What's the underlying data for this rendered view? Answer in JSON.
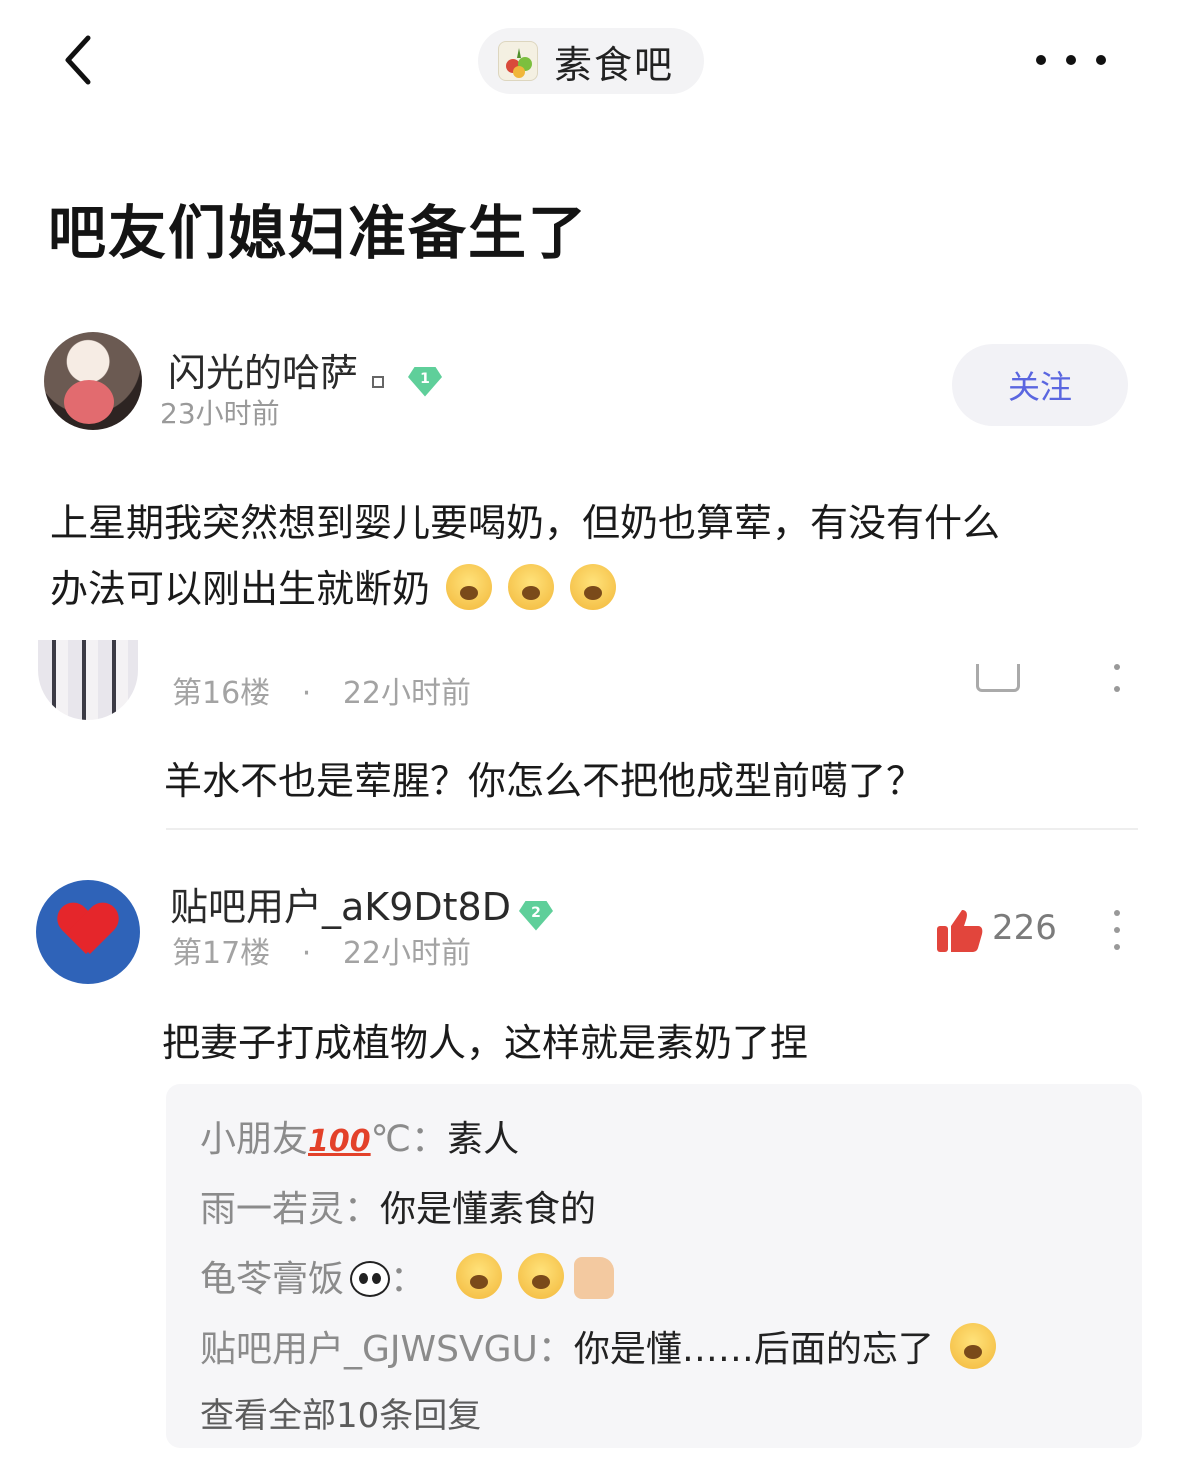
{
  "header": {
    "forum_name": "素食吧",
    "back_icon": "chevron-left-icon",
    "more_icon": "more-horizontal-icon"
  },
  "post": {
    "title": "吧友们媳妇准备生了",
    "author": {
      "name": "闪光的哈萨",
      "level": "1",
      "time": "23小时前"
    },
    "follow_label": "关注",
    "content_line1": "上星期我突然想到婴儿要喝奶，但奶也算荤，有没有什么",
    "content_line2": "办法可以刚出生就断奶"
  },
  "replies": [
    {
      "floor": "第16楼",
      "time": "22小时前",
      "text": "羊水不也是荤腥？你怎么不把他成型前噶了？"
    },
    {
      "author": "贴吧用户_aK9Dt8D",
      "level": "2",
      "floor": "第17楼",
      "time": "22小时前",
      "likes": "226",
      "text": "把妻子打成植物人，这样就是素奶了捏",
      "sub_replies": [
        {
          "user": "小朋友",
          "user_suffix": "100",
          "user_tail": "℃",
          "sep": "：",
          "text": "素人"
        },
        {
          "user": "雨一若灵",
          "sep": "：",
          "text": "你是懂素食的"
        },
        {
          "user": "龟苓膏饭",
          "sep": "：",
          "text": ""
        },
        {
          "user": "贴吧用户_GJWSVGU",
          "sep": "：",
          "text": "你是懂……后面的忘了"
        }
      ],
      "view_all": "查看全部10条回复"
    }
  ],
  "meta_sep": "·"
}
